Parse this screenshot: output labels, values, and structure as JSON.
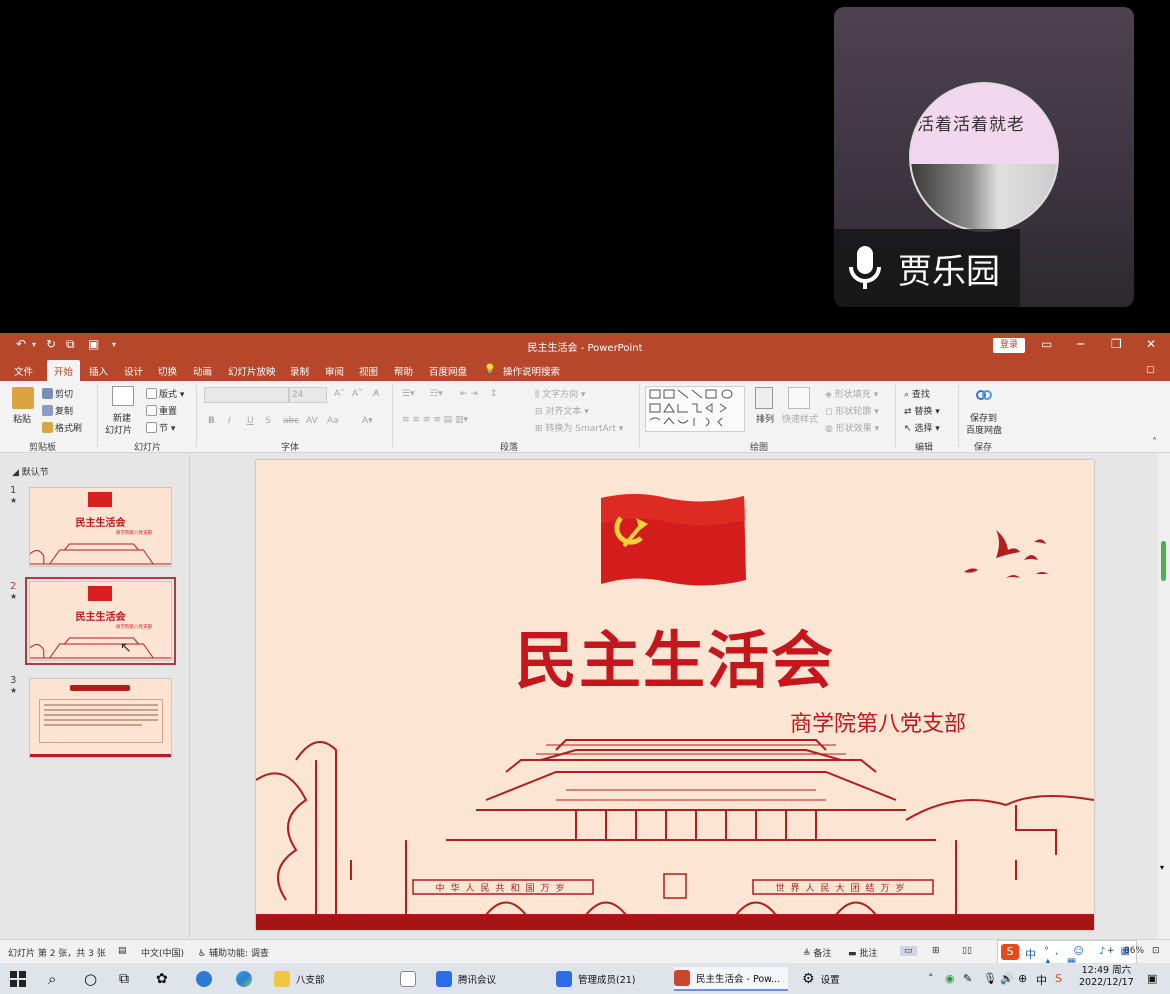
{
  "video": {
    "participant_name": "贾乐园",
    "avatar_text": "活着活着就老"
  },
  "window": {
    "title": "民主生活会 - PowerPoint",
    "login_label": "登录",
    "tell_me": "操作说明搜索"
  },
  "menu": [
    "文件",
    "开始",
    "插入",
    "设计",
    "切换",
    "动画",
    "幻灯片放映",
    "录制",
    "审阅",
    "视图",
    "帮助",
    "百度网盘"
  ],
  "ribbon": {
    "clipboard": {
      "paste": "粘贴",
      "cut": "剪切",
      "copy": "复制",
      "format_painter": "格式刷",
      "label": "剪贴板"
    },
    "slides": {
      "new_slide_1": "新建",
      "new_slide_2": "幻灯片",
      "layout": "版式",
      "reset": "重置",
      "section": "节",
      "label": "幻灯片"
    },
    "font": {
      "size": "24",
      "label": "字体",
      "bold": "B",
      "italic": "I",
      "underline": "U",
      "strike": "S",
      "aa": "Aa"
    },
    "paragraph": {
      "text_direction": "文字方向",
      "align_text": "对齐文本",
      "smartart": "转换为 SmartArt",
      "label": "段落"
    },
    "drawing": {
      "arrange": "排列",
      "quick_styles": "快速样式",
      "shape_fill": "形状填充",
      "shape_outline": "形状轮廓",
      "shape_effects": "形状效果",
      "label": "绘图"
    },
    "editing": {
      "find": "查找",
      "replace": "替换",
      "select": "选择",
      "label": "编辑"
    },
    "save": {
      "save_to_1": "保存到",
      "save_to_2": "百度网盘",
      "label": "保存"
    }
  },
  "slides_panel": {
    "section": "默认节",
    "slides": [
      {
        "num": "1",
        "title": "民主生活会",
        "subtitle": "商学院第八党支部"
      },
      {
        "num": "2",
        "title": "民主生活会",
        "subtitle": "商学院第八党支部"
      },
      {
        "num": "3"
      }
    ]
  },
  "slide": {
    "title": "民主生活会",
    "subtitle": "商学院第八党支部",
    "banner_left": "中华人民共和国万岁",
    "banner_right": "世界人民大团结万岁"
  },
  "status": {
    "slide_info": "幻灯片 第 2 张，共 3 张",
    "language": "中文(中国)",
    "accessibility": "辅助功能: 调查",
    "notes": "备注",
    "comments": "批注",
    "zoom": "86%"
  },
  "ime": {
    "lang": "中"
  },
  "taskbar": {
    "items": [
      "八支部",
      "腾讯会议",
      "管理成员(21)",
      "民主生活会 - Pow...",
      "设置"
    ],
    "time": "12:49 周六",
    "date": "2022/12/17"
  }
}
